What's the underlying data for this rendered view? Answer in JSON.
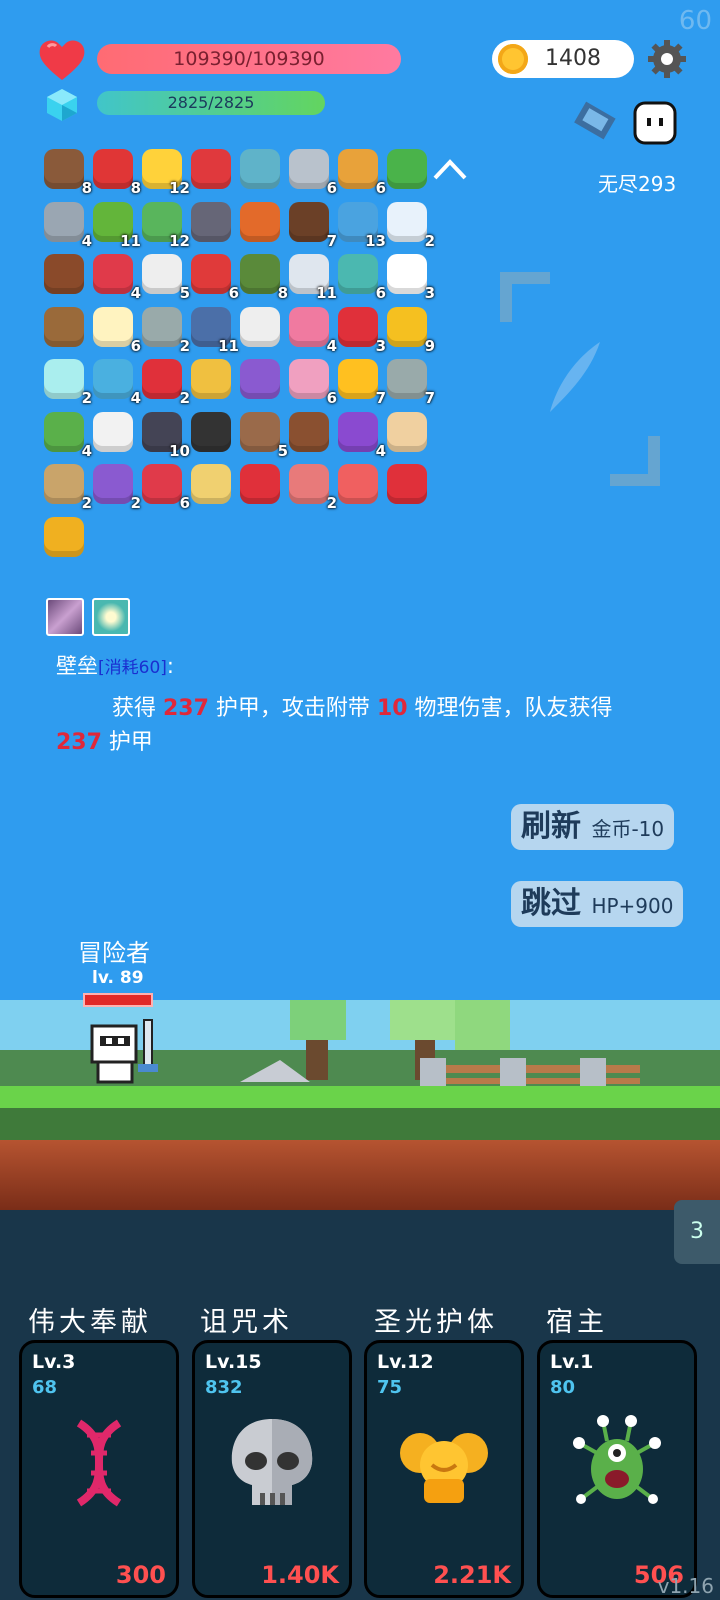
{
  "fps": "60",
  "hp": {
    "text": "109390/109390",
    "fraction": 1.0
  },
  "mp": {
    "text": "2825/2825",
    "fraction": 1.0
  },
  "coins": "1408",
  "endless_label": "无尽293",
  "items": [
    {
      "icon": "shield-round-icon",
      "count": "8",
      "color": "#8a5a3a"
    },
    {
      "icon": "sock-icon",
      "count": "8",
      "color": "#e03636"
    },
    {
      "icon": "crown-icon",
      "count": "12",
      "color": "#ffd23a"
    },
    {
      "icon": "discount-tag-icon",
      "count": "",
      "color": "#e0393d"
    },
    {
      "icon": "magnifier-icon",
      "count": "",
      "color": "#5fb3c9"
    },
    {
      "icon": "sword-icon",
      "count": "6",
      "color": "#b9c2cc"
    },
    {
      "icon": "book-icon",
      "count": "6",
      "color": "#e8a23a"
    },
    {
      "icon": "green-card-icon",
      "count": "",
      "color": "#4ab34a"
    },
    {
      "icon": "battle-axe-icon",
      "count": "4",
      "color": "#9aa6b2"
    },
    {
      "icon": "lime-icon",
      "count": "11",
      "color": "#63b53a"
    },
    {
      "icon": "cash-heart-icon",
      "count": "12",
      "color": "#59b55c"
    },
    {
      "icon": "mortar-icon",
      "count": "",
      "color": "#667"
    },
    {
      "icon": "meteor-icon",
      "count": "",
      "color": "#e36a2a"
    },
    {
      "icon": "coconut-icon",
      "count": "7",
      "color": "#6b4027"
    },
    {
      "icon": "star-card-icon",
      "count": "13",
      "color": "#4aa3e0"
    },
    {
      "icon": "cloud-pillow-icon",
      "count": "2",
      "color": "#e8f2fb"
    },
    {
      "icon": "treasure-chest-icon",
      "count": "",
      "color": "#8a4a2a"
    },
    {
      "icon": "jam-jar-icon",
      "count": "4",
      "color": "#e03a4a"
    },
    {
      "icon": "playing-card-icon",
      "count": "5",
      "color": "#eee"
    },
    {
      "icon": "mushroom-icon",
      "count": "6",
      "color": "#e03a3a"
    },
    {
      "icon": "grenade-icon",
      "count": "8",
      "color": "#5a8a3a"
    },
    {
      "icon": "clipboard-icon",
      "count": "11",
      "color": "#dfe6ee"
    },
    {
      "icon": "target-disc-icon",
      "count": "6",
      "color": "#4bb8b0"
    },
    {
      "icon": "white-flower-icon",
      "count": "3",
      "color": "#fff"
    },
    {
      "icon": "crossbow-icon",
      "count": "",
      "color": "#9a6a3a"
    },
    {
      "icon": "fried-egg-icon",
      "count": "6",
      "color": "#fff3c0"
    },
    {
      "icon": "spiked-mace-icon",
      "count": "2",
      "color": "#9aa"
    },
    {
      "icon": "knight-shield-icon",
      "count": "11",
      "color": "#4b6fa8"
    },
    {
      "icon": "dice-icon",
      "count": "",
      "color": "#eee"
    },
    {
      "icon": "perfume-bottle-icon",
      "count": "4",
      "color": "#f07aa0"
    },
    {
      "icon": "heart-icon",
      "count": "3",
      "color": "#e0303a"
    },
    {
      "icon": "sunflower-icon",
      "count": "9",
      "color": "#f5c020"
    },
    {
      "icon": "capsule-icon",
      "count": "2",
      "color": "#aee"
    },
    {
      "icon": "potion-flask-icon",
      "count": "4",
      "color": "#4ab0e0"
    },
    {
      "icon": "red-apple-icon",
      "count": "2",
      "color": "#e0303a"
    },
    {
      "icon": "ring-icon",
      "count": "",
      "color": "#f0c040"
    },
    {
      "icon": "star-shield-icon",
      "count": "",
      "color": "#8a5ad0"
    },
    {
      "icon": "ice-cream-icon",
      "count": "6",
      "color": "#f0a0c0"
    },
    {
      "icon": "sun-icon",
      "count": "7",
      "color": "#ffc020"
    },
    {
      "icon": "compass-icon",
      "count": "7",
      "color": "#9aa"
    },
    {
      "icon": "slime-monster-icon",
      "count": "4",
      "color": "#5ab04a"
    },
    {
      "icon": "envelope-icon",
      "count": "",
      "color": "#f2f2f2"
    },
    {
      "icon": "bat-icon",
      "count": "10",
      "color": "#445"
    },
    {
      "icon": "cauldron-icon",
      "count": "",
      "color": "#333"
    },
    {
      "icon": "arched-door-icon",
      "count": "5",
      "color": "#9a6a4a"
    },
    {
      "icon": "cake-flag-icon",
      "count": "",
      "color": "#8a5030"
    },
    {
      "icon": "crystal-ball-icon",
      "count": "4",
      "color": "#8a4ad0"
    },
    {
      "icon": "pointing-hand-icon",
      "count": "",
      "color": "#f0d0a0"
    },
    {
      "icon": "noose-icon",
      "count": "2",
      "color": "#c9a46a"
    },
    {
      "icon": "purple-gift-icon",
      "count": "2",
      "color": "#8a5ad0"
    },
    {
      "icon": "watermelon-icon",
      "count": "6",
      "color": "#e03a4a"
    },
    {
      "icon": "map-icon",
      "count": "",
      "color": "#f0d070"
    },
    {
      "icon": "bookmark-icon",
      "count": "",
      "color": "#e0303a"
    },
    {
      "icon": "steak-icon",
      "count": "2",
      "color": "#e87a7a"
    },
    {
      "icon": "pill-icon",
      "count": "",
      "color": "#f06060"
    },
    {
      "icon": "strawberry-icon",
      "count": "",
      "color": "#e0303a"
    },
    {
      "icon": "coin-stack-icon",
      "count": "",
      "color": "#f0b020"
    }
  ],
  "skill_description": {
    "name": "壁垒",
    "cost_label": "[消耗60]",
    "colon": ":",
    "line1_a": "获得 ",
    "line1_num1": "237",
    "line1_b": " 护甲，攻击附带 ",
    "line1_num2": "10",
    "line1_c": " 物理伤害，队友获得",
    "line2_num": "237",
    "line2_b": " 护甲"
  },
  "buttons": {
    "refresh_label": "刷新",
    "refresh_cost": "金币-10",
    "skip_label": "跳过",
    "skip_reward": "HP+900"
  },
  "hero": {
    "name": "冒险者",
    "level": "lv. 89",
    "hp_fraction": 1.0
  },
  "side_tab": "3",
  "cards": [
    {
      "name": "伟大奉献",
      "lv": "Lv.3",
      "cost": "68",
      "value": "300",
      "art": "dna-icon"
    },
    {
      "name": "诅咒术",
      "lv": "Lv.15",
      "cost": "832",
      "value": "1.40K",
      "art": "skull-icon"
    },
    {
      "name": "圣光护体",
      "lv": "Lv.12",
      "cost": "75",
      "value": "2.21K",
      "art": "golden-angel-icon"
    },
    {
      "name": "宿主",
      "lv": "Lv.1",
      "cost": "80",
      "value": "506",
      "art": "green-monster-icon"
    }
  ],
  "version": "v1.16"
}
